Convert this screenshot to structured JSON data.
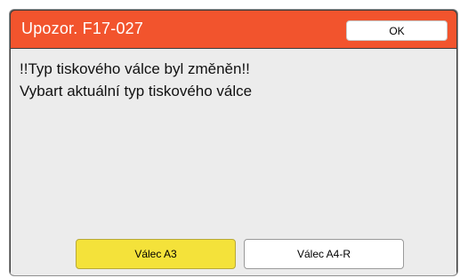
{
  "dialog": {
    "title": "Upozor. F17-027",
    "ok_label": "OK",
    "message_line1": "!!Typ tiskového válce byl změněn!!",
    "message_line2": "Vybart aktuální typ tiskového válce"
  },
  "options": {
    "a3_label": "Válec A3",
    "a4r_label": "Válec A4-R"
  },
  "colors": {
    "title_bar": "#f2542d",
    "selected_option": "#f4e23a",
    "body_background": "#ececec"
  }
}
